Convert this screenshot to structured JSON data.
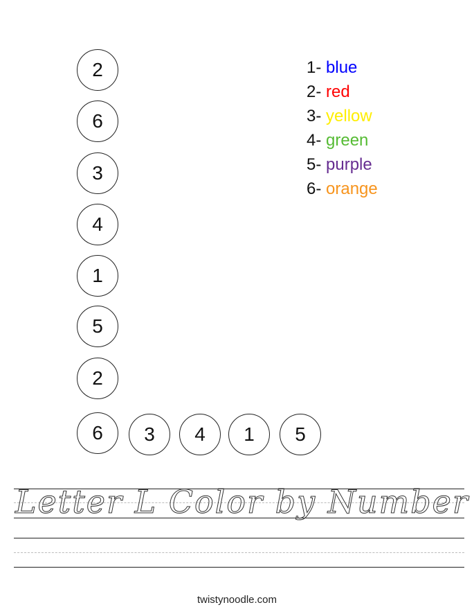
{
  "worksheet": {
    "title": "Letter L Color by Number",
    "footer": "twistynoodle.com",
    "vertical_circles": [
      "2",
      "6",
      "3",
      "4",
      "1",
      "5",
      "2",
      "6"
    ],
    "horizontal_circles": [
      "3",
      "4",
      "1",
      "5"
    ],
    "legend": [
      {
        "number": "1-",
        "color_name": "blue",
        "color": "#0000ff"
      },
      {
        "number": "2-",
        "color_name": "red",
        "color": "#ff0000"
      },
      {
        "number": "3-",
        "color_name": "yellow",
        "color": "#ffee00"
      },
      {
        "number": "4-",
        "color_name": "green",
        "color": "#55bb33"
      },
      {
        "number": "5-",
        "color_name": "purple",
        "color": "#662d91"
      },
      {
        "number": "6-",
        "color_name": "orange",
        "color": "#f7941d"
      }
    ]
  }
}
